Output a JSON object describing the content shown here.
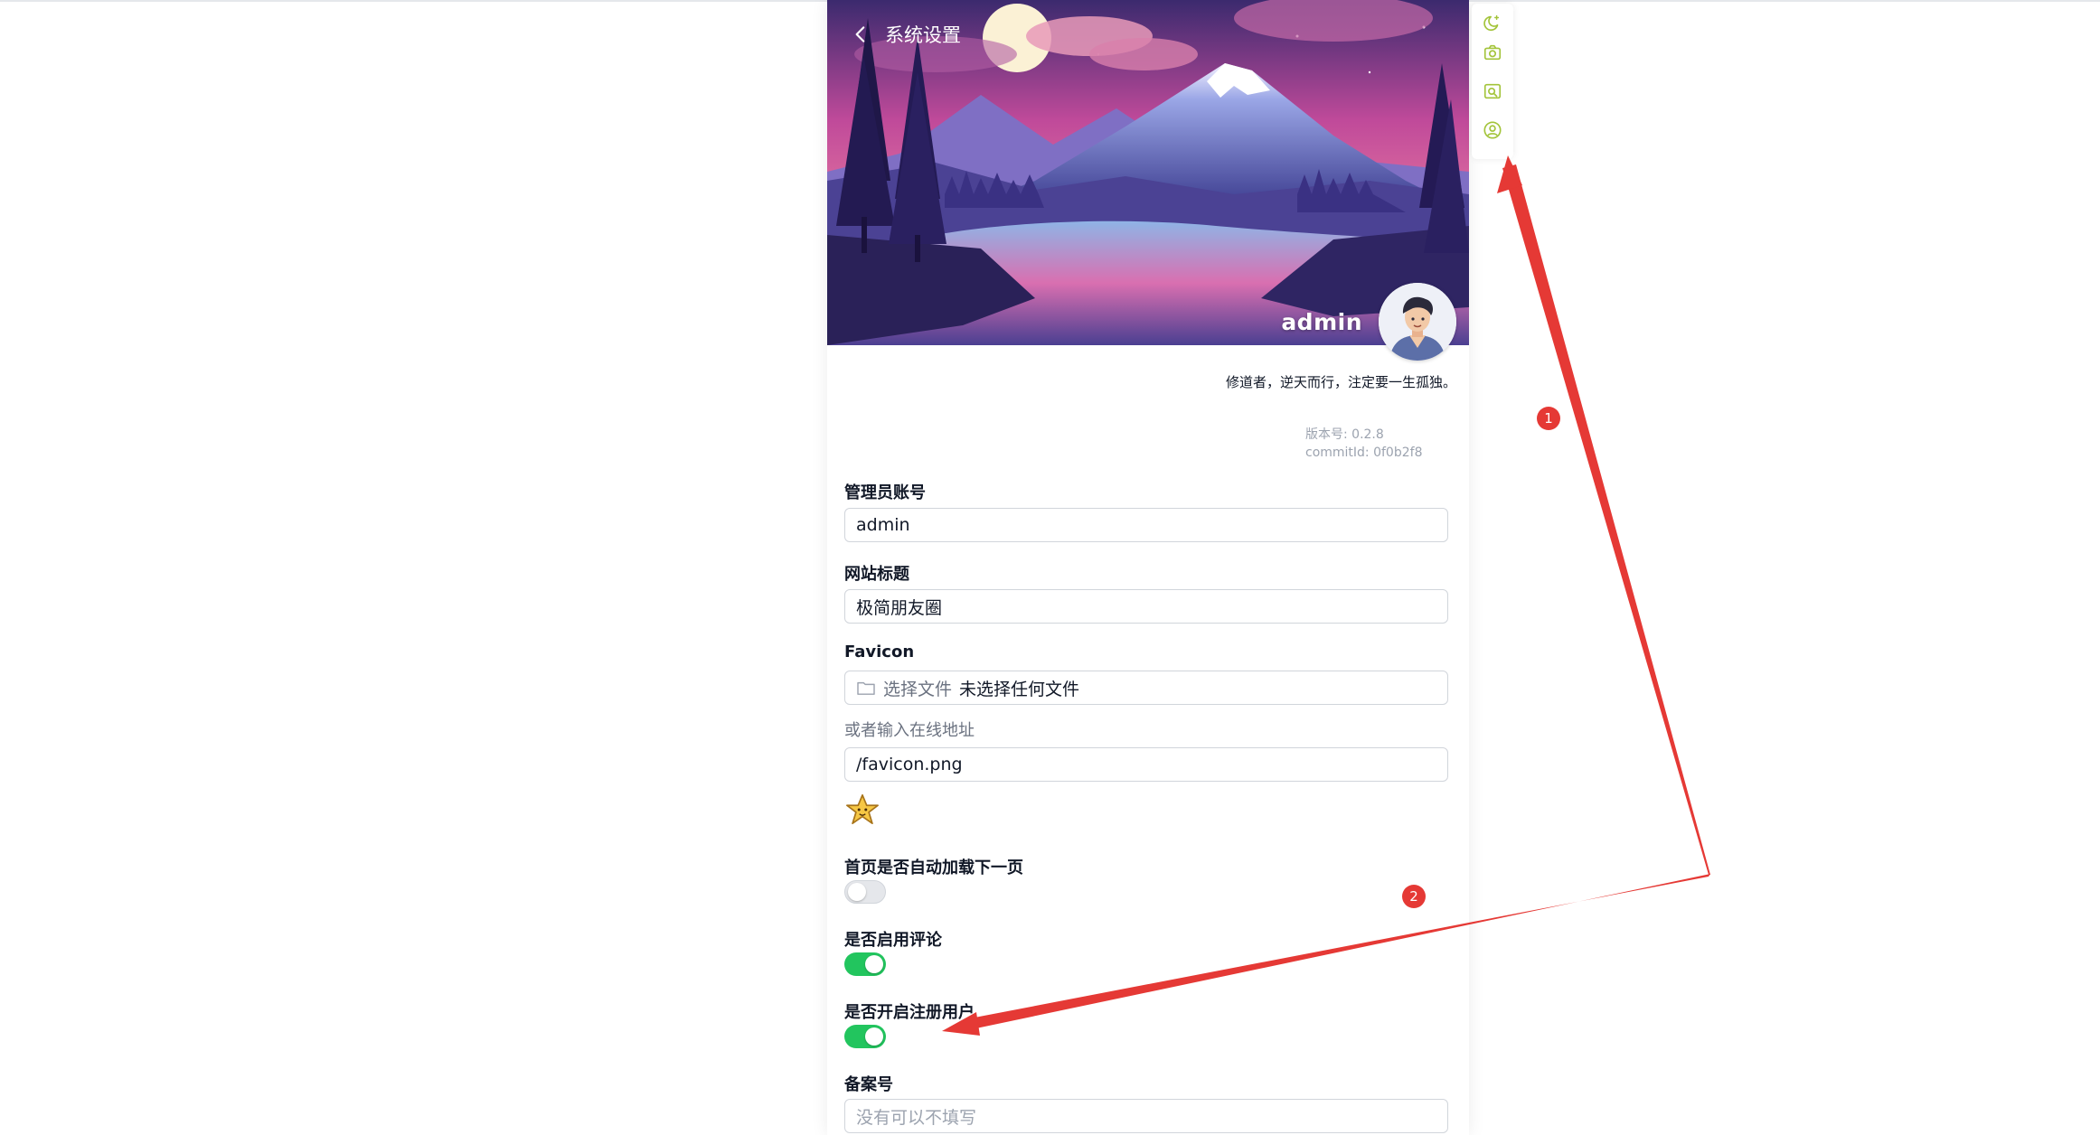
{
  "header": {
    "back_label": "系统设置",
    "username": "admin",
    "motto": "修道者，逆天而行，注定要一生孤独。",
    "version": "版本号: 0.2.8",
    "commit": "commitId: 0f0b2f8"
  },
  "form": {
    "admin_account": {
      "label": "管理员账号",
      "value": "admin"
    },
    "site_title": {
      "label": "网站标题",
      "value": "极简朋友圈"
    },
    "favicon": {
      "label": "Favicon",
      "choose_label": "选择文件",
      "no_file_label": "未选择任何文件",
      "or_online_label": "或者输入在线地址",
      "url_value": "/favicon.png"
    },
    "autoload": {
      "label": "首页是否自动加载下一页",
      "enabled": false
    },
    "comments": {
      "label": "是否启用评论",
      "enabled": true
    },
    "register": {
      "label": "是否开启注册用户",
      "enabled": true
    },
    "icp": {
      "label": "备案号",
      "placeholder": "没有可以不填写"
    }
  },
  "toolbar": {
    "icons": [
      "moon-icon",
      "camera-icon",
      "image-search-icon",
      "user-circle-icon"
    ],
    "accent": "#a3c43a"
  },
  "annotations": {
    "badge_1": "1",
    "badge_2": "2",
    "color": "#e53935"
  },
  "colors": {
    "toggle_on": "#22c55e",
    "toggle_off": "#e5e7eb"
  }
}
